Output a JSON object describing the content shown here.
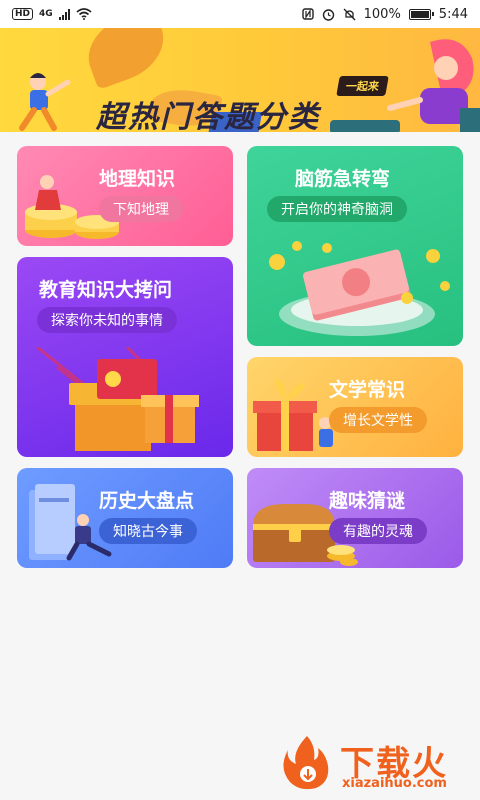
{
  "status_bar": {
    "hd": "HD",
    "network": "4G",
    "battery": "100%",
    "time": "5:44"
  },
  "banner": {
    "tag": "一起来",
    "title": "超热门答题分类"
  },
  "categories": [
    {
      "title": "地理知识",
      "subtitle": "下知地理"
    },
    {
      "title": "脑筋急转弯",
      "subtitle": "开启你的神奇脑洞"
    },
    {
      "title": "教育知识大拷问",
      "subtitle": "探索你未知的事情"
    },
    {
      "title": "文学常识",
      "subtitle": "增长文学性"
    },
    {
      "title": "历史大盘点",
      "subtitle": "知晓古今事"
    },
    {
      "title": "趣味猜谜",
      "subtitle": "有趣的灵魂"
    }
  ],
  "watermark": {
    "brand": "下载火",
    "url": "xiazaihuo.com"
  },
  "colors": {
    "geo": "#ff6e9f",
    "brain": "#2fc98a",
    "edu": "#7f35ef",
    "lit": "#ffbf4d",
    "hist": "#5b86f8",
    "riddle": "#ad72ee",
    "watermark": "#f0611e"
  },
  "icons": [
    "hd-icon",
    "signal-icon",
    "wifi-icon",
    "nfc-icon",
    "alarm-icon",
    "mute-icon",
    "battery-icon"
  ]
}
